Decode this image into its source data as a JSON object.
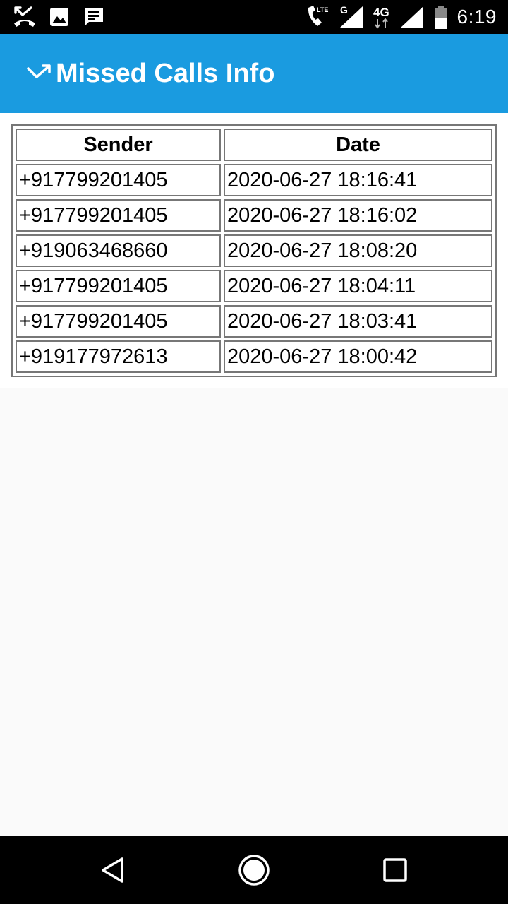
{
  "status_bar": {
    "time": "6:19",
    "network_g": "G",
    "network_4g": "4G",
    "lte": "LTE",
    "icons": [
      "missed-call-icon",
      "image-icon",
      "message-icon",
      "wifi-call-icon",
      "signal-icon",
      "signal-icon",
      "battery-icon"
    ]
  },
  "app_bar": {
    "title": "Missed Calls Info",
    "icon": "missed-call-arrow-icon",
    "color": "#1a9be0"
  },
  "table": {
    "headers": {
      "sender": "Sender",
      "date": "Date"
    },
    "rows": [
      {
        "sender": "+917799201405",
        "date": "2020-06-27 18:16:41"
      },
      {
        "sender": "+917799201405",
        "date": "2020-06-27 18:16:02"
      },
      {
        "sender": "+919063468660",
        "date": "2020-06-27 18:08:20"
      },
      {
        "sender": "+917799201405",
        "date": "2020-06-27 18:04:11"
      },
      {
        "sender": "+917799201405",
        "date": "2020-06-27 18:03:41"
      },
      {
        "sender": "+919177972613",
        "date": "2020-06-27 18:00:42"
      }
    ]
  },
  "nav_bar": {
    "buttons": [
      "back-icon",
      "home-icon",
      "recents-icon"
    ]
  }
}
